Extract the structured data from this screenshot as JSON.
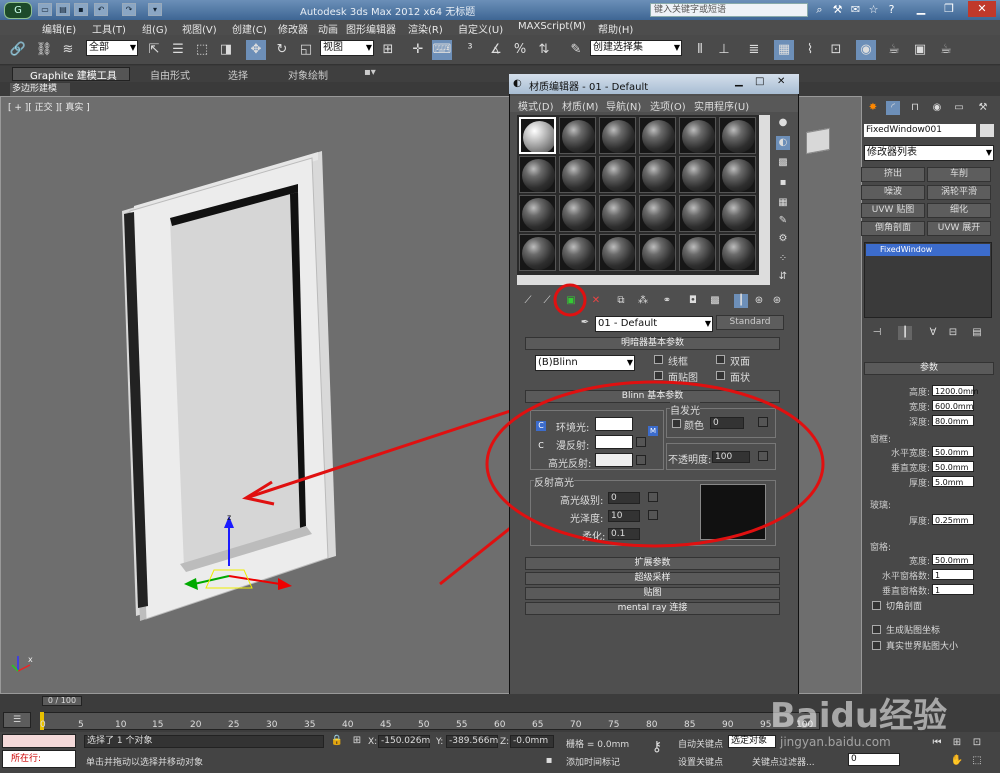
{
  "app": {
    "title": "Autodesk 3ds Max  2012 x64      无标题",
    "icon_text": "G",
    "search_placeholder": "键入关键字或短语"
  },
  "menu": [
    "编辑(E)",
    "工具(T)",
    "组(G)",
    "视图(V)",
    "创建(C)",
    "修改器",
    "动画",
    "图形编辑器",
    "渲染(R)",
    "自定义(U)",
    "MAXScript(M)",
    "帮助(H)"
  ],
  "toolbar": {
    "selection_filter": "全部",
    "ref_coord": "视图",
    "named_selection": "创建选择集"
  },
  "ribbon": {
    "tabs": [
      "Graphite 建模工具",
      "自由形式",
      "选择",
      "对象绘制"
    ],
    "sub_tab": "多边形建模"
  },
  "viewport": {
    "label": "[ + ][ 正交 ][ 真实 ]",
    "axis_z": "z",
    "axis_x": "x"
  },
  "material_editor": {
    "title": "材质编辑器 - 01 - Default",
    "menu": [
      "模式(D)",
      "材质(M)",
      "导航(N)",
      "选项(O)",
      "实用程序(U)"
    ],
    "material_name": "01 - Default",
    "material_type": "Standard",
    "rollouts": {
      "shader_basic": "明暗器基本参数",
      "blinn_basic": "Blinn 基本参数",
      "extended": "扩展参数",
      "supersampling": "超级采样",
      "maps": "贴图",
      "mental_ray": "mental ray 连接"
    },
    "shader": {
      "type": "(B)Blinn",
      "wire": "线框",
      "two_sided": "双面",
      "face_map": "面贴图",
      "faceted": "面状"
    },
    "blinn": {
      "ambient": "环境光:",
      "diffuse": "漫反射:",
      "specular": "高光反射:",
      "self_illum": "自发光",
      "color_label": "颜色",
      "self_illum_value": "0",
      "opacity_label": "不透明度:",
      "opacity_value": "100",
      "lock_c": "C",
      "map_m": "M"
    },
    "specular_highlights": {
      "header": "反射高光",
      "level_label": "高光级别:",
      "level_value": "0",
      "gloss_label": "光泽度:",
      "gloss_value": "10",
      "soften_label": "柔化:",
      "soften_value": "0.1"
    }
  },
  "command_panel": {
    "object_name": "FixedWindow001",
    "modifier_list": "修改器列表",
    "modifier_buttons": [
      "挤出",
      "车削",
      "噪波",
      "涡轮平滑",
      "UVW 贴图",
      "细化",
      "倒角剖面",
      "UVW 展开"
    ],
    "stack_item": "FixedWindow",
    "params_header": "参数",
    "params": {
      "height_label": "高度:",
      "height": "1200.0mm",
      "width_label": "宽度:",
      "width": "600.0mm",
      "depth_label": "深度:",
      "depth": "80.0mm",
      "frame_header": "窗框:",
      "h_width_label": "水平宽度:",
      "h_width": "50.0mm",
      "v_width_label": "垂直宽度:",
      "v_width": "50.0mm",
      "frame_thick_label": "厚度:",
      "frame_thick": "5.0mm",
      "glass_header": "玻璃:",
      "glass_thick_label": "厚度:",
      "glass_thick": "0.25mm",
      "sash_header": "窗格:",
      "sash_width_label": "宽度:",
      "sash_width": "50.0mm",
      "h_panes_label": "水平窗格数:",
      "h_panes": "1",
      "v_panes_label": "垂直窗格数:",
      "v_panes": "1",
      "chamfer": "切角剖面",
      "gen_mapping": "生成贴图坐标",
      "real_world": "真实世界贴图大小"
    }
  },
  "timeline": {
    "slider": "0 / 100",
    "ticks": [
      "0",
      "5",
      "10",
      "15",
      "20",
      "25",
      "30",
      "35",
      "40",
      "45",
      "50",
      "55",
      "60",
      "65",
      "70",
      "75",
      "80",
      "85",
      "90",
      "95",
      "100"
    ]
  },
  "status": {
    "script_label": "所在行:",
    "selected": "选择了 1 个对象",
    "prompt": "单击并拖动以选择并移动对象",
    "x_label": "X:",
    "x": "-150.026m",
    "y_label": "Y:",
    "y": "-389.566m",
    "z_label": "Z:",
    "z": "-0.0mm",
    "grid": "栅格 = 0.0mm",
    "add_time_tag": "添加时间标记",
    "auto_key": "自动关键点",
    "selected_obj": "选定对象",
    "set_key": "设置关键点",
    "key_filters": "关键点过滤器...",
    "frame": "0"
  },
  "watermark": {
    "brand": "Baidu经验",
    "url": "jingyan.baidu.com"
  },
  "colors": {
    "annotation_red": "#e01010",
    "viewport_bg": "#6e6e6e",
    "titlebar": "#4d76a3"
  }
}
